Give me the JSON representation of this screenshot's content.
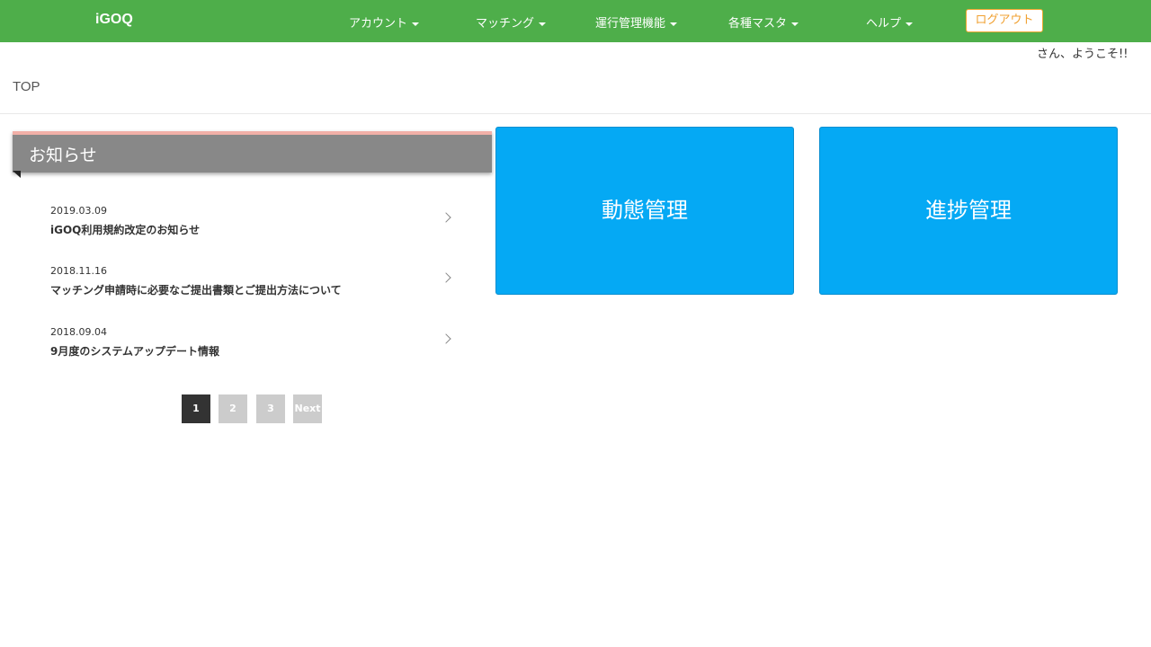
{
  "app": {
    "brand": "iGOQ"
  },
  "nav": {
    "items": [
      {
        "label": "アカウント"
      },
      {
        "label": "マッチング"
      },
      {
        "label": "運行管理機能"
      },
      {
        "label": "各種マスタ"
      },
      {
        "label": "ヘルプ"
      }
    ],
    "logout_label": "ログアウト"
  },
  "welcome_text": "さん、ようこそ!!",
  "breadcrumb": "TOP",
  "news": {
    "title": "お知らせ",
    "items": [
      {
        "date": "2019.03.09",
        "text": "iGOQ利用規約改定のお知らせ"
      },
      {
        "date": "2018.11.16",
        "text": "マッチング申請時に必要なご提出書類とご提出方法について"
      },
      {
        "date": "2018.09.04",
        "text": "9月度のシステムアップデート情報"
      }
    ],
    "pagination": [
      "1",
      "2",
      "3",
      "Next"
    ],
    "current_page": "1"
  },
  "tiles": [
    {
      "label": "動態管理"
    },
    {
      "label": "進捗管理"
    }
  ],
  "colors": {
    "navbar": "#4eae4a",
    "tile": "#05a9f4",
    "news_header": "#888888",
    "news_accent": "#f2b0a8",
    "logout_border": "#f0a830"
  }
}
